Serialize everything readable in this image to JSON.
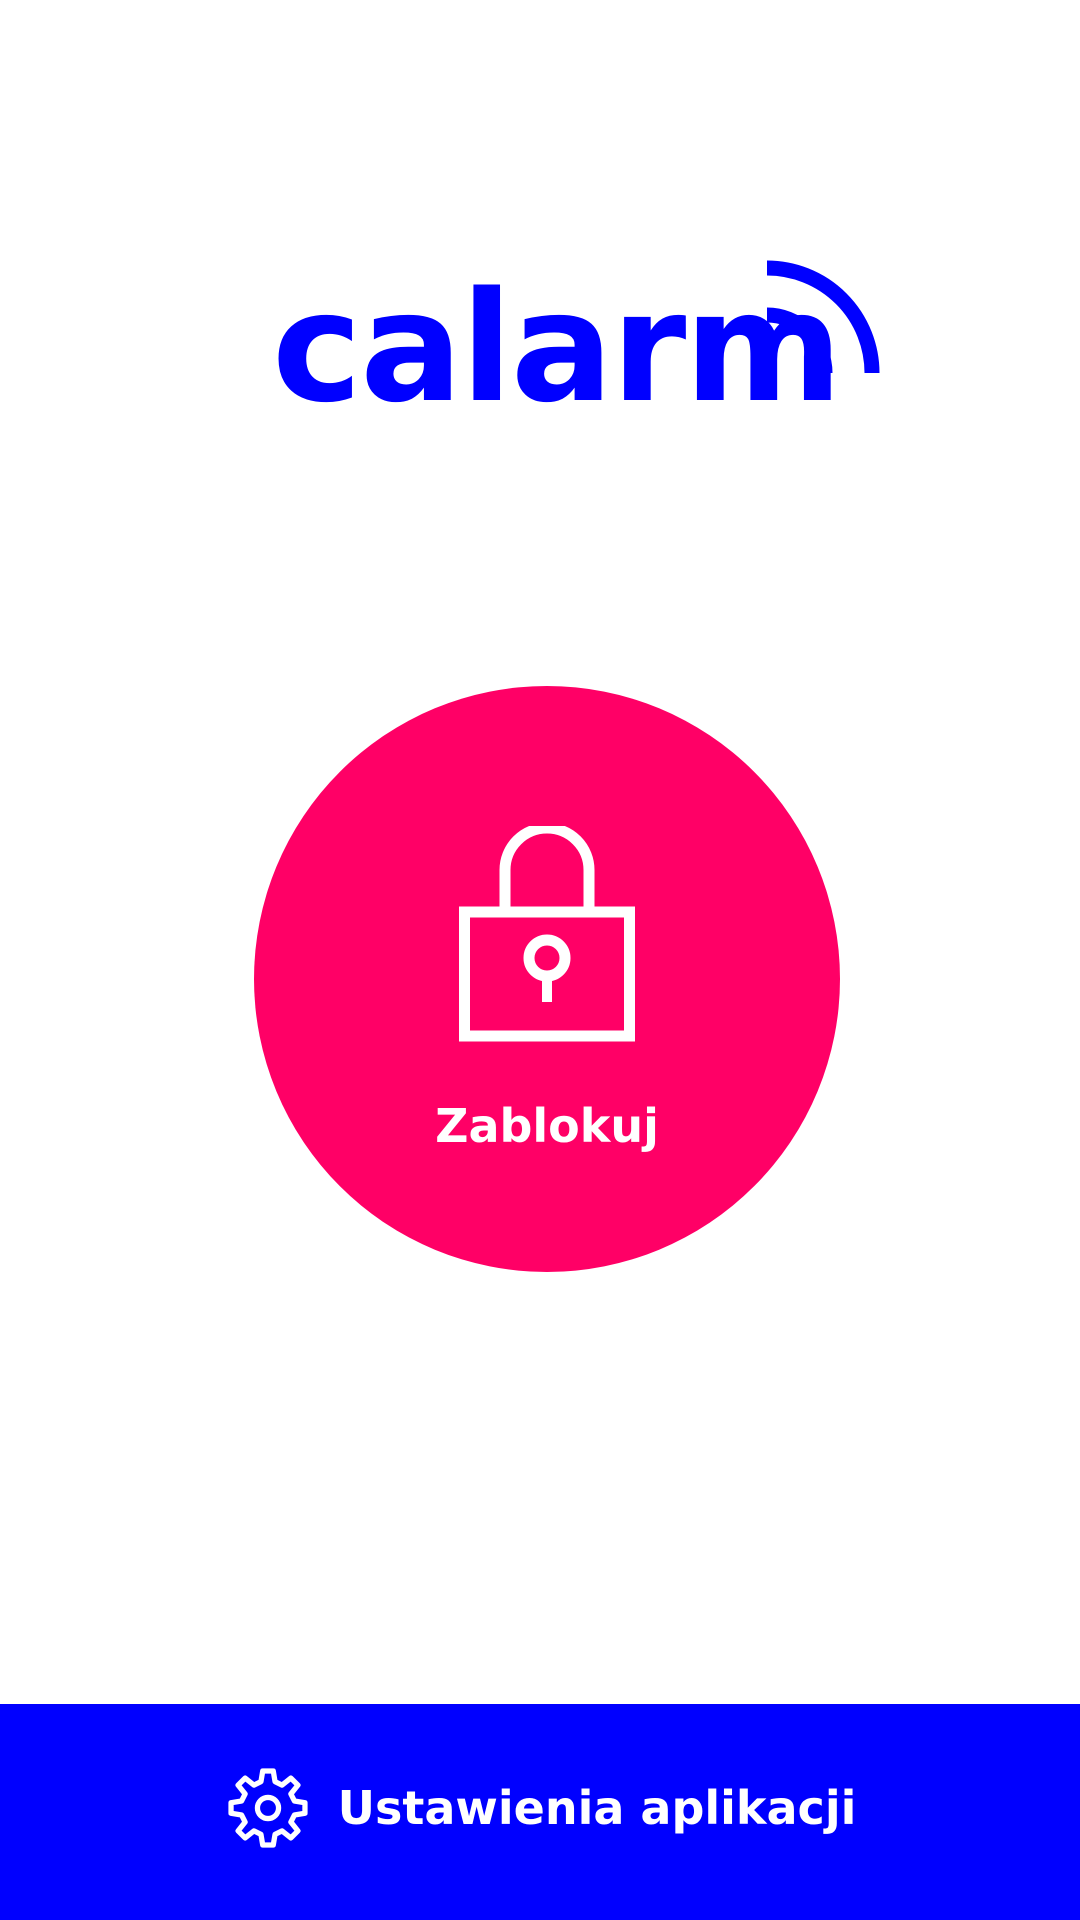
{
  "app": {
    "logo_text": "calarm",
    "logo_icon": "signal-waves-icon"
  },
  "lock_button": {
    "label": "Zablokuj",
    "icon": "padlock-icon"
  },
  "settings": {
    "label": "Ustawienia aplikacji",
    "icon": "gear-icon"
  },
  "colors": {
    "brand_blue": "#0000ff",
    "lock_pink": "#ff0066",
    "background": "#ffffff",
    "on_accent_text": "#ffffff"
  }
}
